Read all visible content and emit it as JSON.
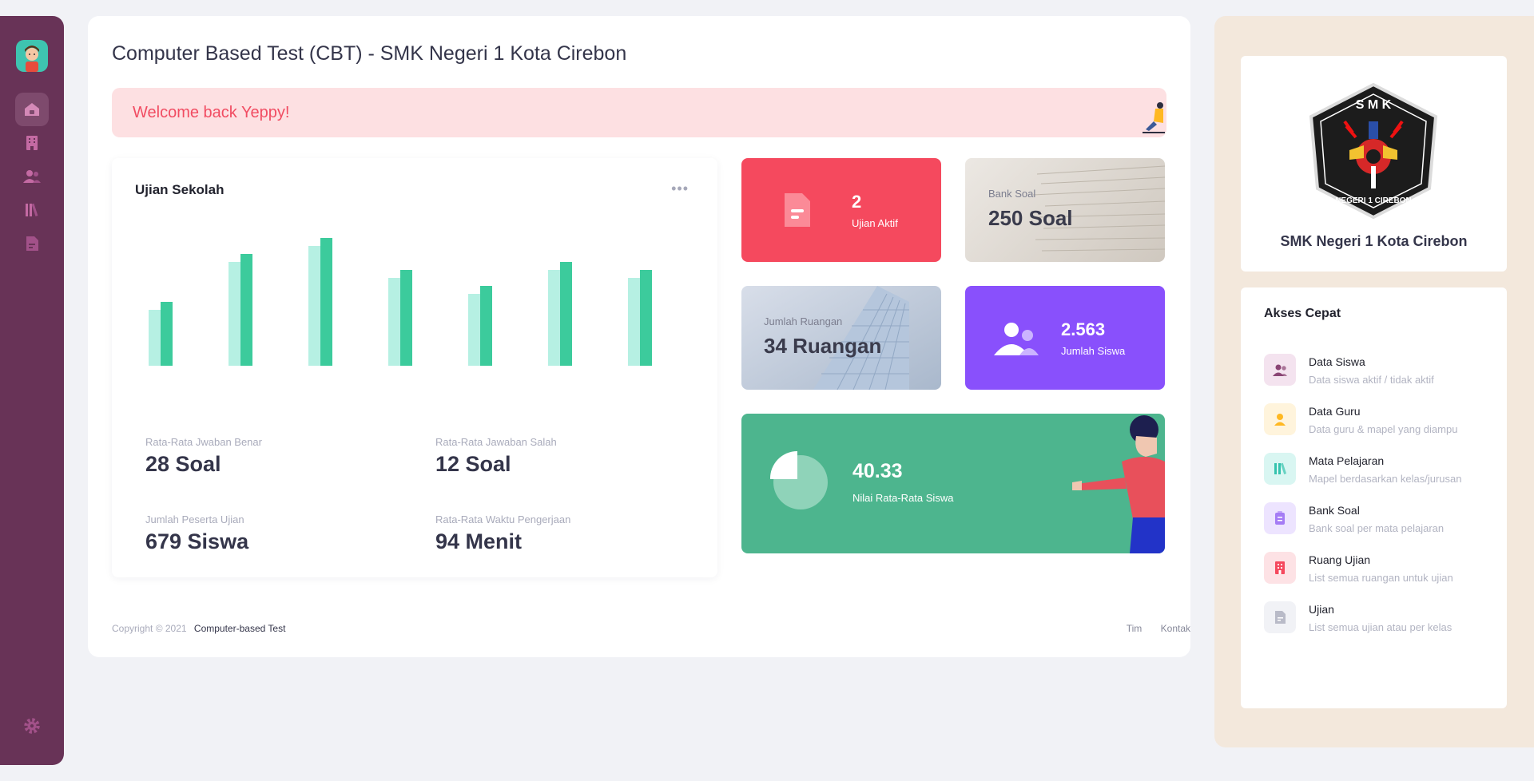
{
  "sidebar": {
    "nav": [
      "home",
      "building",
      "users",
      "books",
      "document"
    ]
  },
  "header": {
    "title": "Computer Based Test (CBT) - SMK Negeri 1 Kota Cirebon"
  },
  "welcome": {
    "text": "Welcome back Yeppy!"
  },
  "exam_card": {
    "title": "Ujian Sekolah",
    "stats": [
      {
        "label": "Rata-Rata Jwaban Benar",
        "value": "28 Soal"
      },
      {
        "label": "Rata-Rata Jawaban Salah",
        "value": "12 Soal"
      },
      {
        "label": "Jumlah Peserta Ujian",
        "value": "679 Siswa"
      },
      {
        "label": "Rata-Rata Waktu Pengerjaan",
        "value": "94 Menit"
      }
    ]
  },
  "chart_data": {
    "type": "bar",
    "categories": [
      "",
      "",
      "",
      "",
      "",
      "",
      ""
    ],
    "series": [
      {
        "values": [
          70,
          130,
          150,
          110,
          90,
          120,
          110
        ],
        "color": "#b6f0e3"
      },
      {
        "values": [
          80,
          140,
          160,
          120,
          100,
          130,
          120
        ],
        "color": "#3ccb9c"
      }
    ],
    "ylim": [
      0,
      170
    ],
    "grid": false
  },
  "tiles": {
    "active_exams": {
      "value": "2",
      "label": "Ujian Aktif",
      "color": "#f5495e"
    },
    "question_bank": {
      "label": "Bank Soal",
      "value": "250 Soal"
    },
    "rooms": {
      "label": "Jumlah Ruangan",
      "value": "34 Ruangan"
    },
    "students": {
      "value": "2.563",
      "label": "Jumlah Siswa",
      "color": "#8950fc"
    },
    "average": {
      "value": "40.33",
      "label": "Nilai Rata-Rata Siswa",
      "color": "#4db58e"
    }
  },
  "footer": {
    "copyright": "Copyright © 2021",
    "link": "Computer-based Test",
    "links": [
      "Tim",
      "Kontak"
    ]
  },
  "school": {
    "name": "SMK Negeri 1 Kota Cirebon",
    "logo_top": "S M K",
    "logo_bottom": "NEGERI 1 CIREBON"
  },
  "quick_access": {
    "title": "Akses Cepat",
    "items": [
      {
        "title": "Data Siswa",
        "subtitle": "Data siswa aktif / tidak aktif",
        "icon": "users-icon",
        "bg": "#f4e3ef",
        "fg": "#8a4474"
      },
      {
        "title": "Data Guru",
        "subtitle": "Data guru & mapel yang diampu",
        "icon": "user-icon",
        "bg": "#fff4dc",
        "fg": "#ffb822"
      },
      {
        "title": "Mata Pelajaran",
        "subtitle": "Mapel berdasarkan kelas/jurusan",
        "icon": "books-icon",
        "bg": "#d9f6f2",
        "fg": "#35c3ae"
      },
      {
        "title": "Bank Soal",
        "subtitle": "Bank soal per mata pelajaran",
        "icon": "clipboard-icon",
        "bg": "#ede4ff",
        "fg": "#a57cf5"
      },
      {
        "title": "Ruang Ujian",
        "subtitle": "List semua ruangan untuk ujian",
        "icon": "building-icon",
        "bg": "#fde2e5",
        "fg": "#f5495e"
      },
      {
        "title": "Ujian",
        "subtitle": "List semua ujian atau per kelas",
        "icon": "document-icon",
        "bg": "#f1f2f6",
        "fg": "#b9bbc8"
      }
    ]
  }
}
